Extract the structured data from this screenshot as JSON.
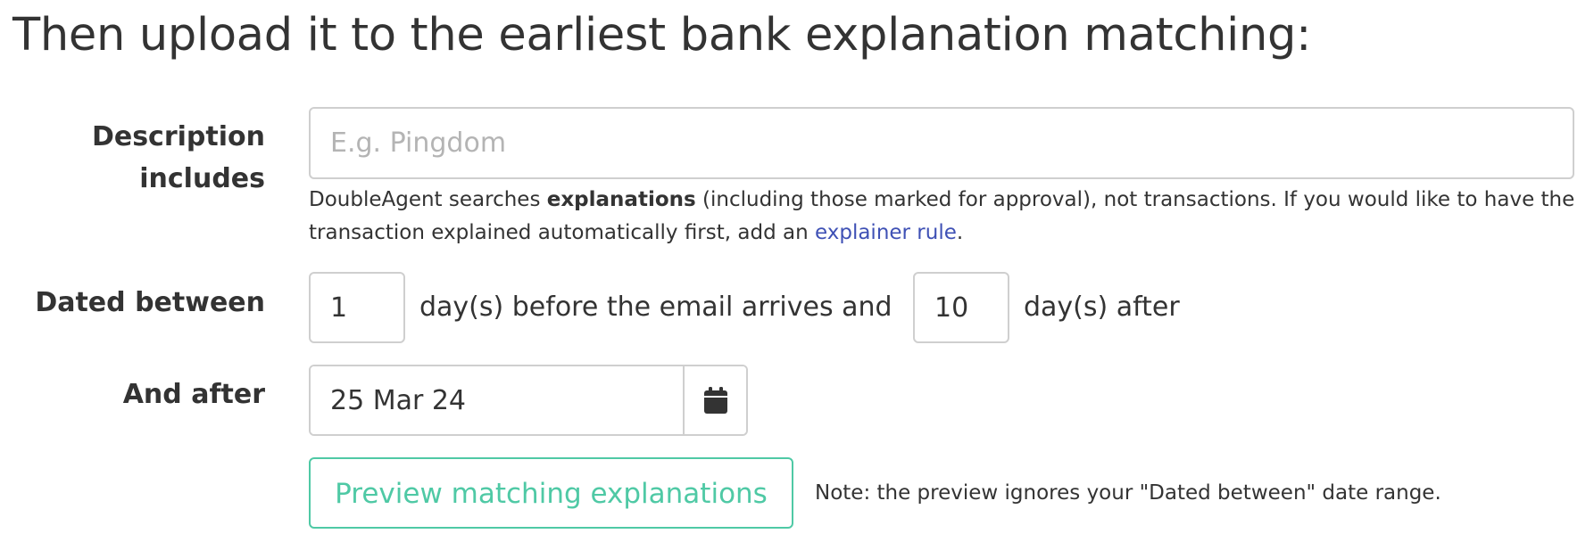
{
  "heading": "Then upload it to the earliest bank explanation matching:",
  "description": {
    "label": "Description includes",
    "placeholder": "E.g. Pingdom",
    "value": "",
    "help": {
      "prefix": "DoubleAgent searches ",
      "bold": "explanations",
      "middle": " (including those marked for approval), not transactions. If you would like to have the transaction explained automatically first, add an ",
      "link": "explainer rule",
      "suffix": "."
    }
  },
  "dated_between": {
    "label": "Dated between",
    "before_value": "1",
    "before_text": "day(s) before the email arrives and",
    "after_value": "10",
    "after_text": "day(s) after"
  },
  "and_after": {
    "label": "And after",
    "date_value": "25 Mar 24",
    "icon": "calendar-icon"
  },
  "preview": {
    "button_label": "Preview matching explanations",
    "note": "Note: the preview ignores your \"Dated between\" date range."
  },
  "colors": {
    "accent": "#4fc9a5",
    "link": "#3f51b5",
    "text": "#333333",
    "border": "#cfcfcf",
    "placeholder": "#b4b4b4"
  }
}
